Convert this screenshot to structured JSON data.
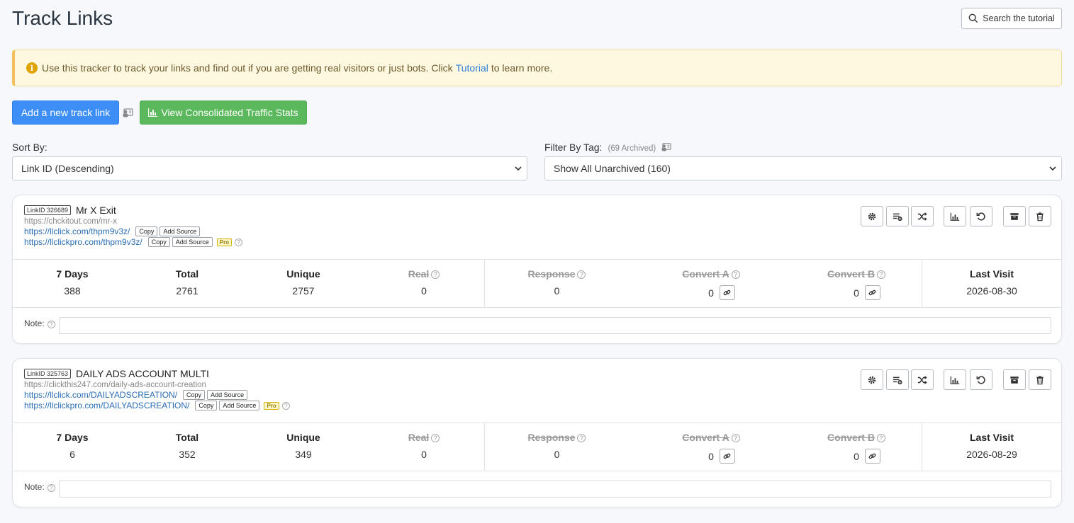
{
  "page": {
    "title": "Track Links",
    "search_label": "Search the tutorial"
  },
  "alert": {
    "text_before": "Use this tracker to track your links and find out if you are getting real visitors or just bots. Click",
    "link_text": "Tutorial",
    "text_after": "to learn more."
  },
  "actions": {
    "add_label": "Add a new track link",
    "consolidated_label": "View Consolidated Traffic Stats"
  },
  "sort": {
    "label": "Sort By:",
    "selected": "Link ID (Descending)"
  },
  "filter": {
    "label": "Filter By Tag:",
    "archived_note": "(69 Archived)",
    "selected": "Show All Unarchived (160)"
  },
  "stat_headers": {
    "days7": "7 Days",
    "total": "Total",
    "unique": "Unique",
    "real": "Real",
    "response": "Response",
    "convert_a": "Convert A",
    "convert_b": "Convert B",
    "last_visit": "Last Visit"
  },
  "common": {
    "copy": "Copy",
    "add_source": "Add Source",
    "pro": "Pro",
    "note_label": "Note:",
    "q": "?"
  },
  "links": [
    {
      "link_id": "LinkID 326689",
      "name": "Mr X Exit",
      "source_url": "https://chckitout.com/mr-x",
      "track_url_1": "https://llclick.com/thpm9v3z/",
      "track_url_2": "https://llclickpro.com/thpm9v3z/",
      "stats": {
        "days7": "388",
        "total": "2761",
        "unique": "2757",
        "real": "0",
        "response": "0",
        "convert_a": "0",
        "convert_b": "0",
        "last_visit": "2026-08-30"
      }
    },
    {
      "link_id": "LinkID 325763",
      "name": "DAILY ADS ACCOUNT MULTI",
      "source_url": "https://clickthis247.com/daily-ads-account-creation",
      "track_url_1": "https://llclick.com/DAILYADSCREATION/",
      "track_url_2": "https://llclickpro.com/DAILYADSCREATION/",
      "stats": {
        "days7": "6",
        "total": "352",
        "unique": "349",
        "real": "0",
        "response": "0",
        "convert_a": "0",
        "convert_b": "0",
        "last_visit": "2026-08-29"
      }
    }
  ]
}
